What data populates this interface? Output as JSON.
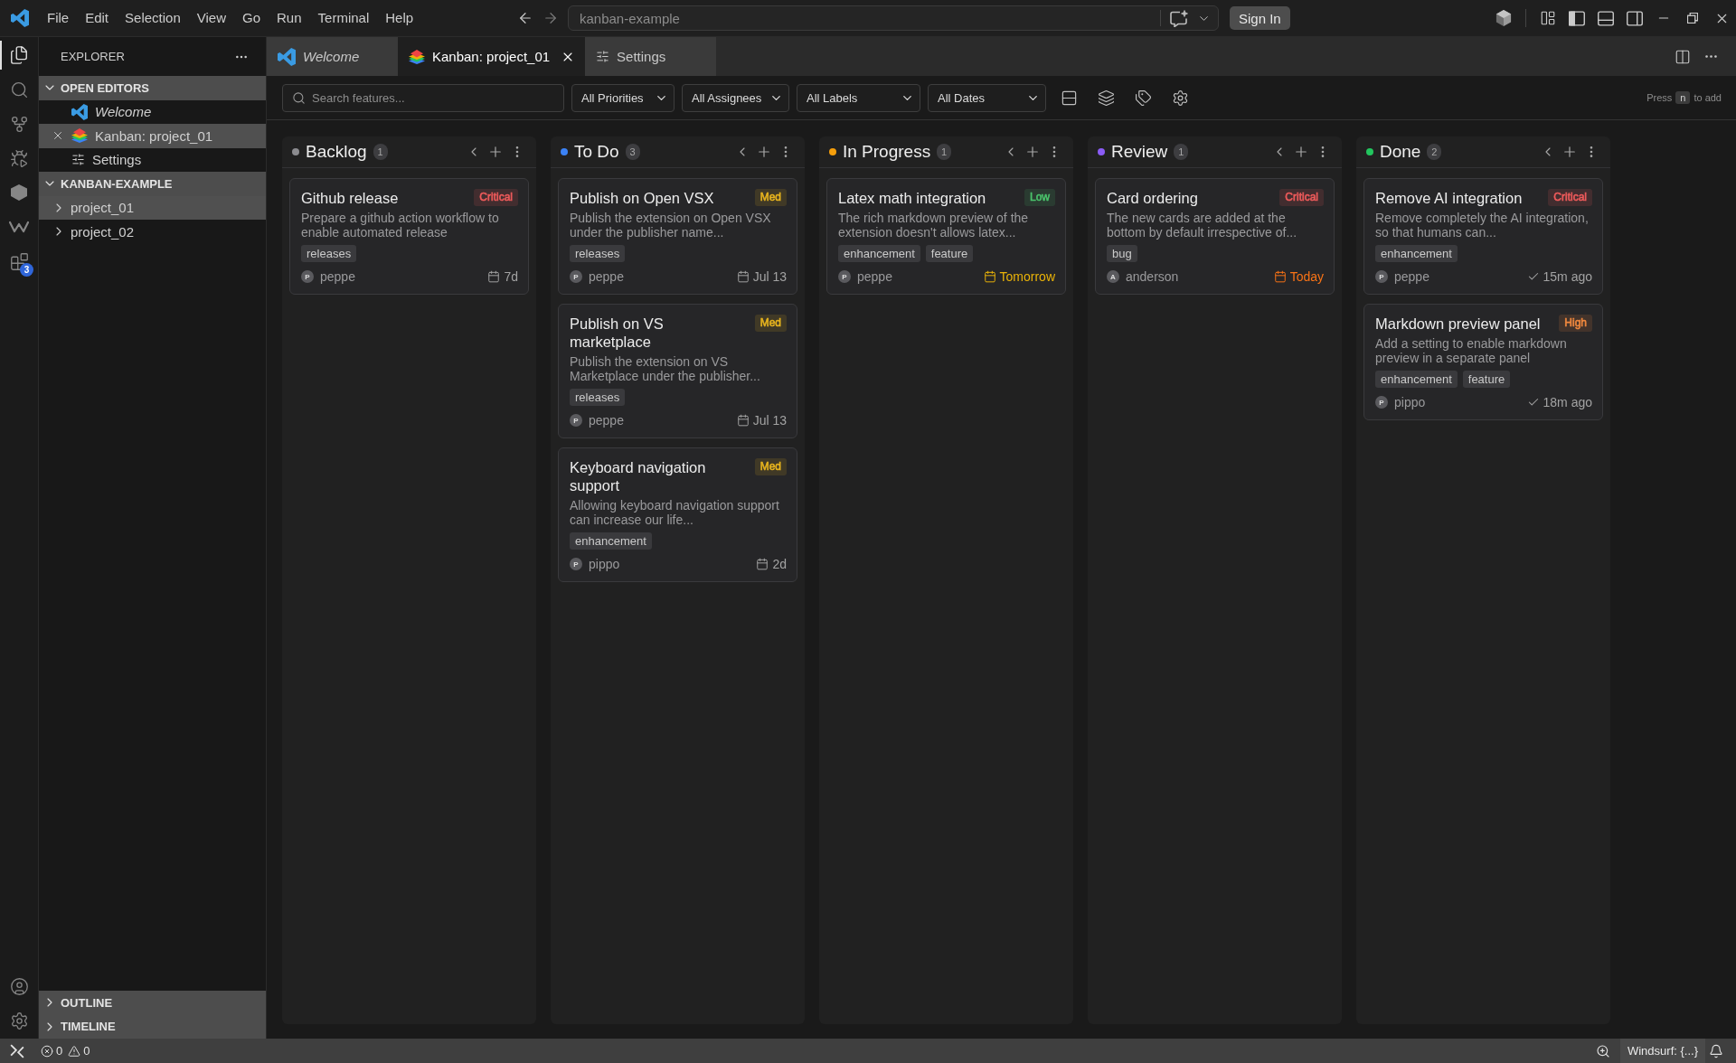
{
  "title_bar": {
    "menu": [
      "File",
      "Edit",
      "Selection",
      "View",
      "Go",
      "Run",
      "Terminal",
      "Help"
    ],
    "command_center": {
      "label": "kanban-example"
    },
    "sign_in": "Sign In",
    "layout_toggles": [
      {
        "on": true
      },
      {
        "on": false
      },
      {
        "on": false
      }
    ]
  },
  "activity_bar": {
    "items": [
      {
        "selected": true
      },
      {
        "selected": false
      },
      {
        "selected": false
      },
      {
        "selected": false
      },
      {
        "selected": false
      },
      {
        "selected": false
      },
      {
        "selected": false,
        "badge": "3"
      }
    ]
  },
  "sidebar": {
    "title": "EXPLORER",
    "sections": [
      {
        "title": "OPEN EDITORS",
        "expanded": true,
        "items": [
          {
            "label": "Welcome",
            "kind": "welcome",
            "preview": true,
            "selected": false
          },
          {
            "label": "Kanban: project_01",
            "kind": "kanban",
            "preview": false,
            "selected": true
          },
          {
            "label": "Settings",
            "kind": "settings",
            "preview": false,
            "selected": false
          }
        ]
      },
      {
        "title": "KANBAN-EXAMPLE",
        "expanded": true,
        "items": [
          {
            "label": "project_01",
            "kind": "folder",
            "expanded": false,
            "selected": true
          },
          {
            "label": "project_02",
            "kind": "folder",
            "expanded": false,
            "selected": false
          }
        ]
      }
    ],
    "bottom_sections": [
      {
        "title": "OUTLINE",
        "expanded": false
      },
      {
        "title": "TIMELINE",
        "expanded": false
      }
    ]
  },
  "tabs": [
    {
      "label": "Welcome",
      "kind": "welcome",
      "preview": true,
      "selected": false
    },
    {
      "label": "Kanban: project_01",
      "kind": "kanban",
      "preview": false,
      "selected": true
    },
    {
      "label": "Settings",
      "kind": "settings",
      "preview": false,
      "selected": false
    }
  ],
  "toolbar": {
    "search": {
      "placeholder": "Search features..."
    },
    "filters": [
      "All Priorities",
      "All Assignees",
      "All Labels",
      "All Dates"
    ],
    "hint": {
      "before": "Press",
      "key": "n",
      "after": "to add"
    }
  },
  "columns": [
    {
      "title": "Backlog",
      "count": "1",
      "color": "#8b8b8f",
      "cards": [
        {
          "title": "Github release",
          "priority": {
            "label": "Critical",
            "color": "#ef5b5b"
          },
          "description": "Prepare a github action workflow to enable automated release",
          "tags": [
            "releases"
          ],
          "assignee": {
            "initial": "P",
            "name": "peppe"
          },
          "status": {
            "kind": "due",
            "label": "7d",
            "color": "#a3a3a3"
          }
        }
      ]
    },
    {
      "title": "To Do",
      "count": "3",
      "color": "#3b82f6",
      "cards": [
        {
          "title": "Publish on Open VSX",
          "priority": {
            "label": "Med",
            "color": "#e6b31e"
          },
          "description": "Publish the extension on Open VSX under the publisher name...",
          "tags": [
            "releases"
          ],
          "assignee": {
            "initial": "P",
            "name": "peppe"
          },
          "status": {
            "kind": "due",
            "label": "Jul 13",
            "color": "#a3a3a3"
          }
        },
        {
          "title": "Publish on VS marketplace",
          "priority": {
            "label": "Med",
            "color": "#e6b31e"
          },
          "description": "Publish the extension on VS Marketplace under the publisher...",
          "tags": [
            "releases"
          ],
          "assignee": {
            "initial": "P",
            "name": "peppe"
          },
          "status": {
            "kind": "due",
            "label": "Jul 13",
            "color": "#a3a3a3"
          }
        },
        {
          "title": "Keyboard navigation support",
          "priority": {
            "label": "Med",
            "color": "#e6b31e"
          },
          "description": "Allowing keyboard navigation support can increase our life...",
          "tags": [
            "enhancement"
          ],
          "assignee": {
            "initial": "P",
            "name": "pippo"
          },
          "status": {
            "kind": "due",
            "label": "2d",
            "color": "#a3a3a3"
          }
        }
      ]
    },
    {
      "title": "In Progress",
      "count": "1",
      "color": "#f59e0b",
      "cards": [
        {
          "title": "Latex math integration",
          "priority": {
            "label": "Low",
            "color": "#4ac26b"
          },
          "description": "The rich markdown preview of the extension doesn't allows latex...",
          "tags": [
            "enhancement",
            "feature"
          ],
          "assignee": {
            "initial": "P",
            "name": "peppe"
          },
          "status": {
            "kind": "due",
            "label": "Tomorrow",
            "color": "#eab308"
          }
        }
      ]
    },
    {
      "title": "Review",
      "count": "1",
      "color": "#8b5cf6",
      "cards": [
        {
          "title": "Card ordering",
          "priority": {
            "label": "Critical",
            "color": "#ef5b5b"
          },
          "description": "The new cards are added at the bottom by default irrespective of...",
          "tags": [
            "bug"
          ],
          "assignee": {
            "initial": "A",
            "name": "anderson"
          },
          "status": {
            "kind": "due",
            "label": "Today",
            "color": "#f97316"
          }
        }
      ]
    },
    {
      "title": "Done",
      "count": "2",
      "color": "#22c55e",
      "cards": [
        {
          "title": "Remove AI integration",
          "priority": {
            "label": "Critical",
            "color": "#ef5b5b"
          },
          "description": "Remove completely the AI integration, so that humans can...",
          "tags": [
            "enhancement"
          ],
          "assignee": {
            "initial": "P",
            "name": "peppe"
          },
          "status": {
            "kind": "completed",
            "label": "15m ago",
            "color": "#a3a3a3"
          }
        },
        {
          "title": "Markdown preview panel",
          "priority": {
            "label": "High",
            "color": "#f0883e"
          },
          "description": "Add a setting to enable markdown preview in a separate panel",
          "tags": [
            "enhancement",
            "feature"
          ],
          "assignee": {
            "initial": "P",
            "name": "pippo"
          },
          "status": {
            "kind": "completed",
            "label": "18m ago",
            "color": "#a3a3a3"
          }
        }
      ]
    }
  ],
  "status_bar": {
    "errors": "0",
    "warnings": "0",
    "items": [
      "Windsurf: {...}"
    ]
  }
}
